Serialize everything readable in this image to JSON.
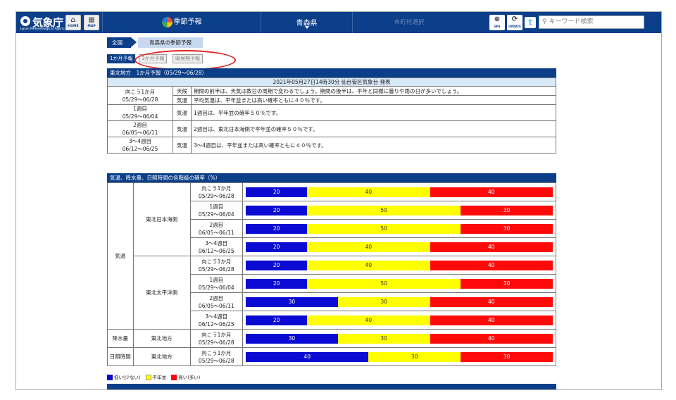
{
  "header": {
    "logo_name": "気象庁",
    "logo_sub": "Japan Meteorological Agency",
    "home_label": "HOME",
    "map_label": "MAP",
    "nav_season": "季節予報",
    "nav_pref": "青森県",
    "nav_city": "市町村選択",
    "gps_label": "GPS",
    "update_label": "UPDATE",
    "twitter_icon": "twitter-icon",
    "search_placeholder": "キーワード検索"
  },
  "breadcrumb": {
    "all": "全国",
    "current": "青森県の季節予報"
  },
  "tabs": [
    "1か月予報",
    "3か月予報",
    "暖候期予報"
  ],
  "forecast": {
    "title": "東北地方　1か月予報（05/29〜06/28）",
    "published": "2021年05月27日14時30分 仙台管区気象台 発表",
    "rows": [
      {
        "period": "向こう1か月",
        "dates": "05/29〜06/28",
        "kind": "天候",
        "text": "期間の前半は、天気は数日の周期で変わるでしょう。期間の後半は、平年と同様に曇りや雨の日が多いでしょう。"
      },
      {
        "kind": "気温",
        "text": "平均気温は、平年並または高い確率ともに４０％です。"
      },
      {
        "period": "1週目",
        "dates": "05/29〜06/04",
        "kind": "気温",
        "text": "1週目は、平年並の確率５０％です。"
      },
      {
        "period": "2週目",
        "dates": "06/05〜06/11",
        "kind": "気温",
        "text": "2週目は、東北日本海側で平年並の確率５０％です。"
      },
      {
        "period": "3〜4週目",
        "dates": "06/12〜06/25",
        "kind": "気温",
        "text": "3〜4週目は、平年並または高い確率ともに４０％です。"
      }
    ]
  },
  "probability": {
    "title": "気温、降水量、日照時間の各階級の確率（%）",
    "element_temp": "気温",
    "element_precip": "降水量",
    "element_sun": "日照時間",
    "region_japan_sea": "東北日本海側",
    "region_pacific": "東北太平洋側",
    "region_tohoku": "東北地方",
    "rows": [
      {
        "period": "向こう1か月",
        "dates": "05/29〜06/28",
        "low": 20,
        "normal": 40,
        "high": 40
      },
      {
        "period": "1週目",
        "dates": "05/29〜06/04",
        "low": 20,
        "normal": 50,
        "high": 30
      },
      {
        "period": "2週目",
        "dates": "06/05〜06/11",
        "low": 20,
        "normal": 50,
        "high": 30
      },
      {
        "period": "3〜4週目",
        "dates": "06/12〜06/25",
        "low": 20,
        "normal": 40,
        "high": 40
      },
      {
        "period": "向こう1か月",
        "dates": "05/29〜06/28",
        "low": 20,
        "normal": 40,
        "high": 40
      },
      {
        "period": "1週目",
        "dates": "05/29〜06/04",
        "low": 20,
        "normal": 50,
        "high": 30
      },
      {
        "period": "2週目",
        "dates": "06/05〜06/11",
        "low": 30,
        "normal": 30,
        "high": 40
      },
      {
        "period": "3〜4週目",
        "dates": "06/12〜06/25",
        "low": 20,
        "normal": 40,
        "high": 40
      },
      {
        "period": "向こう1か月",
        "dates": "05/29〜06/28",
        "low": 30,
        "normal": 30,
        "high": 40
      },
      {
        "period": "向こう1か月",
        "dates": "05/29〜06/28",
        "low": 40,
        "normal": 30,
        "high": 30
      }
    ]
  },
  "legend": {
    "low": "低い(少ない)",
    "normal": "平年並",
    "high": "高い(多い)"
  },
  "colors": {
    "brand": "#0b3f8a",
    "low": "#0a0ad2",
    "normal": "#ffff00",
    "high": "#ff0a0a",
    "highlight_ellipse": "#e02020"
  }
}
